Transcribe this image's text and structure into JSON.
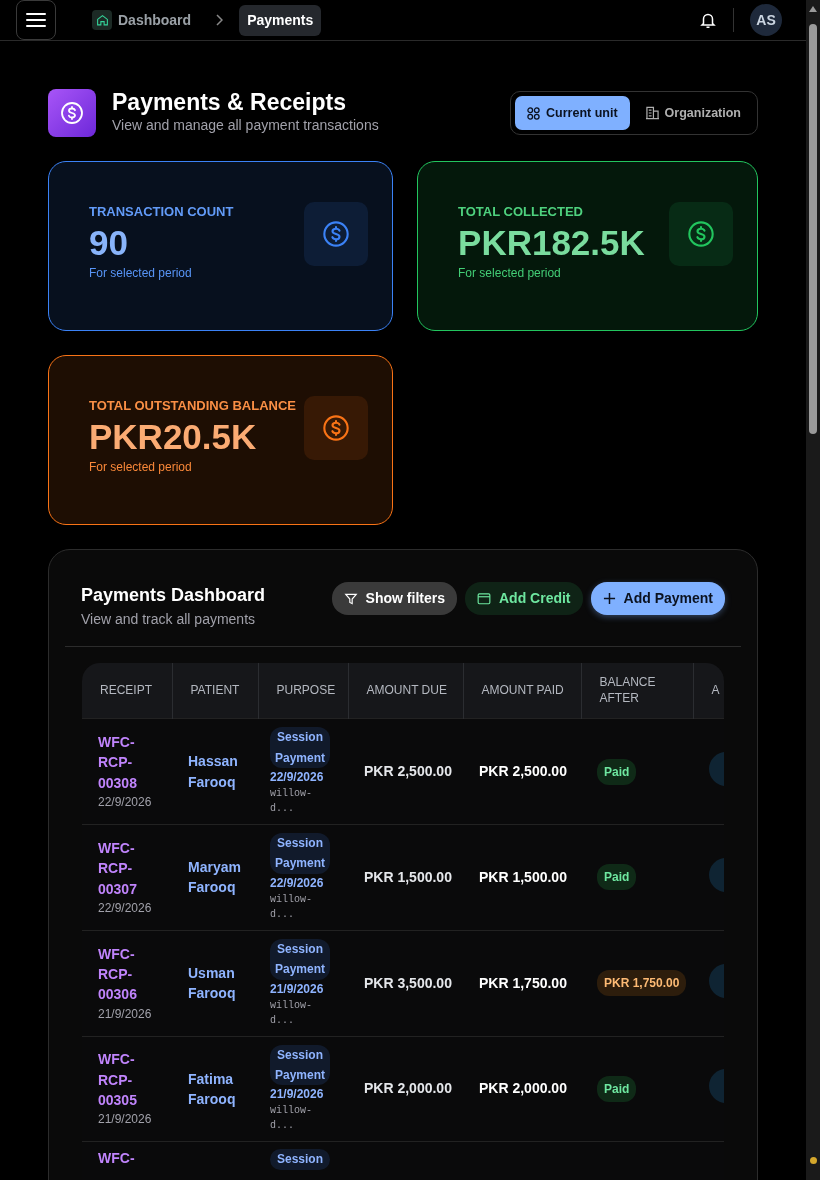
{
  "navbar": {
    "breadcrumbs": [
      {
        "label": "Dashboard",
        "selected": false
      },
      {
        "label": "Payments",
        "selected": true
      }
    ],
    "avatar": "AS"
  },
  "header": {
    "title": "Payments & Receipts",
    "subtitle": "View and manage all payment transactions"
  },
  "scope_toggle": [
    {
      "label": "Current unit",
      "selected": true
    },
    {
      "label": "Organization",
      "selected": false
    }
  ],
  "stats": [
    {
      "label": "TRANSACTION COUNT",
      "value": "90",
      "note": "For selected period",
      "color": "#3b82f6"
    },
    {
      "label": "TOTAL COLLECTED",
      "value": "PKR182.5K",
      "note": "For selected period",
      "color": "#22c55e"
    },
    {
      "label": "TOTAL OUTSTANDING BALANCE",
      "value": "PKR20.5K",
      "note": "For selected period",
      "color": "#f97316"
    }
  ],
  "dashboard": {
    "title": "Payments Dashboard",
    "subtitle": "View and track all payments",
    "buttons": [
      {
        "label": "Show filters",
        "kind": "filter"
      },
      {
        "label": "Add Credit",
        "kind": "credit"
      },
      {
        "label": "Add Payment",
        "kind": "add"
      }
    ],
    "table": {
      "columns": [
        "RECEIPT",
        "PATIENT",
        "PURPOSE",
        "AMOUNT DUE",
        "AMOUNT PAID",
        "BALANCE AFTER",
        "A"
      ],
      "rows": [
        {
          "receipt": "WFC-RCP-00308",
          "date": "22/9/2026",
          "patient": "Hassan Farooq",
          "purpose": "Session Payment",
          "purpose_date": "22/9/2026",
          "note": "willow-d...",
          "due": "PKR 2,500.00",
          "paid": "PKR 2,500.00",
          "balance": {
            "text": "Paid",
            "kind": "paid"
          }
        },
        {
          "receipt": "WFC-RCP-00307",
          "date": "22/9/2026",
          "patient": "Maryam Farooq",
          "purpose": "Session Payment",
          "purpose_date": "22/9/2026",
          "note": "willow-d...",
          "due": "PKR 1,500.00",
          "paid": "PKR 1,500.00",
          "balance": {
            "text": "Paid",
            "kind": "paid"
          }
        },
        {
          "receipt": "WFC-RCP-00306",
          "date": "21/9/2026",
          "patient": "Usman Farooq",
          "purpose": "Session Payment",
          "purpose_date": "21/9/2026",
          "note": "willow-d...",
          "due": "PKR 3,500.00",
          "paid": "PKR 1,750.00",
          "balance": {
            "text": "PKR 1,750.00",
            "kind": "owed"
          }
        },
        {
          "receipt": "WFC-RCP-00305",
          "date": "21/9/2026",
          "patient": "Fatima Farooq",
          "purpose": "Session Payment",
          "purpose_date": "21/9/2026",
          "note": "willow-d...",
          "due": "PKR 2,000.00",
          "paid": "PKR 2,000.00",
          "balance": {
            "text": "Paid",
            "kind": "paid"
          }
        },
        {
          "receipt": "WFC-",
          "purpose": "Session"
        }
      ]
    }
  }
}
